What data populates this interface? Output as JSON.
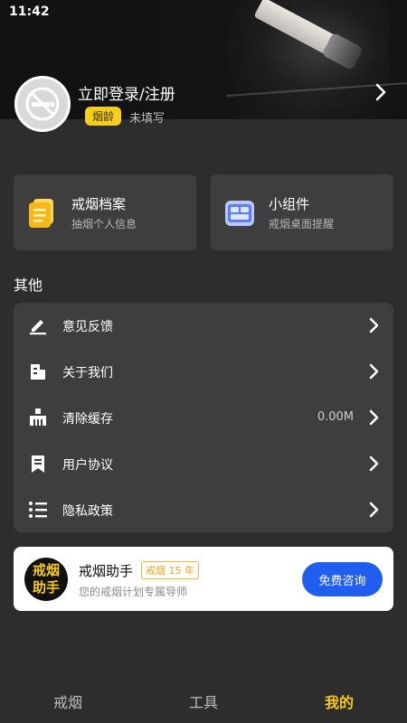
{
  "status_bar": {
    "time": "11:42"
  },
  "profile": {
    "login_text": "立即登录/注册",
    "age_badge": "烟龄",
    "age_value": "未填写"
  },
  "cards": [
    {
      "title": "戒烟档案",
      "subtitle": "抽烟个人信息",
      "icon": "file-stack-icon",
      "color": "#f7c41f"
    },
    {
      "title": "小组件",
      "subtitle": "戒烟桌面提醒",
      "icon": "widget-icon",
      "color": "#5b7cf6"
    }
  ],
  "section_title": "其他",
  "menu": [
    {
      "label": "意见反馈",
      "icon": "edit-icon",
      "value": ""
    },
    {
      "label": "关于我们",
      "icon": "building-icon",
      "value": ""
    },
    {
      "label": "清除缓存",
      "icon": "cleaner-icon",
      "value": "0.00M"
    },
    {
      "label": "用户协议",
      "icon": "bookmark-icon",
      "value": ""
    },
    {
      "label": "隐私政策",
      "icon": "list-icon",
      "value": ""
    }
  ],
  "promo": {
    "logo_line1": "戒烟",
    "logo_line2": "助手",
    "title": "戒烟助手",
    "tag": "戒烟 15 年",
    "subtitle": "您的戒烟计划专属导师",
    "button": "免费咨询"
  },
  "tabs": [
    {
      "label": "戒烟",
      "active": false
    },
    {
      "label": "工具",
      "active": false
    },
    {
      "label": "我的",
      "active": true
    }
  ],
  "colors": {
    "accent": "#f7c91a",
    "button_blue": "#1f5eee",
    "background": "#2d2d2d",
    "card": "#3e3e3e"
  }
}
